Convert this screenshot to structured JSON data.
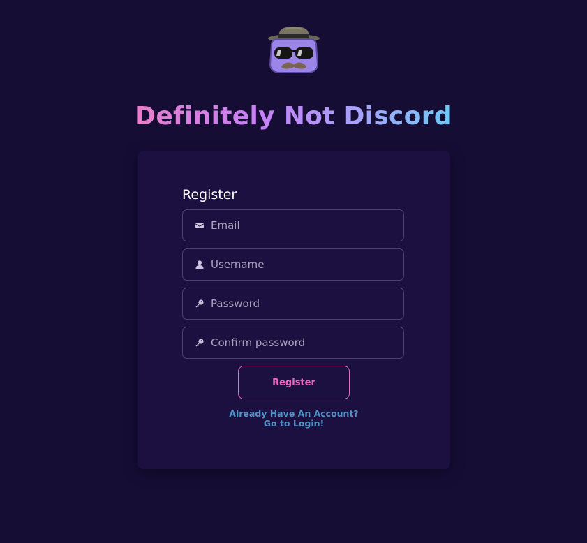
{
  "app": {
    "title": "Definitely Not Discord",
    "logo": "incognito-mascot-icon"
  },
  "colors": {
    "background": "#160d35",
    "card": "#1b103f",
    "accent_pink": "#ee68bf",
    "link_blue": "#4f93c9",
    "field_border": "#4c4470"
  },
  "form": {
    "heading": "Register",
    "fields": [
      {
        "icon": "envelope-icon",
        "placeholder": "Email",
        "value": ""
      },
      {
        "icon": "user-icon",
        "placeholder": "Username",
        "value": ""
      },
      {
        "icon": "key-icon",
        "placeholder": "Password",
        "value": ""
      },
      {
        "icon": "key-icon",
        "placeholder": "Confirm password",
        "value": ""
      }
    ],
    "submit_label": "Register",
    "login_link": {
      "line1": "Already Have An Account?",
      "line2": "Go to Login!"
    }
  }
}
